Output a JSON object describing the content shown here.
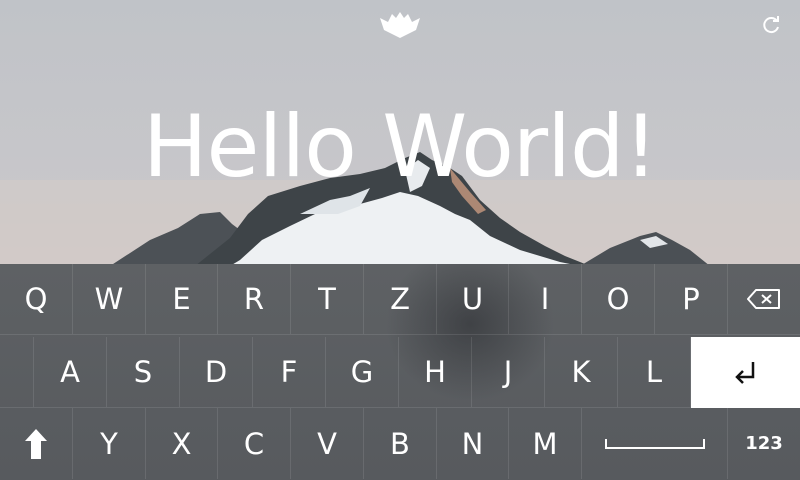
{
  "header": {
    "logo_icon": "bat-logo-icon",
    "refresh_icon": "refresh-icon"
  },
  "headline": "Hello World!",
  "keyboard": {
    "row1": [
      "Q",
      "W",
      "E",
      "R",
      "T",
      "Z",
      "U",
      "I",
      "O",
      "P"
    ],
    "row2": [
      "A",
      "S",
      "D",
      "F",
      "G",
      "H",
      "J",
      "K",
      "L"
    ],
    "row3": [
      "Y",
      "X",
      "C",
      "V",
      "B",
      "N",
      "M"
    ],
    "backspace_icon": "backspace-icon",
    "enter_icon": "enter-icon",
    "shift_icon": "shift-arrow-icon",
    "space_icon": "space-bar-icon",
    "numbers_label": "123"
  },
  "colors": {
    "keyboard_bg": "#5b5e62",
    "enter_bg": "#ffffff",
    "key_text": "#ffffff"
  }
}
